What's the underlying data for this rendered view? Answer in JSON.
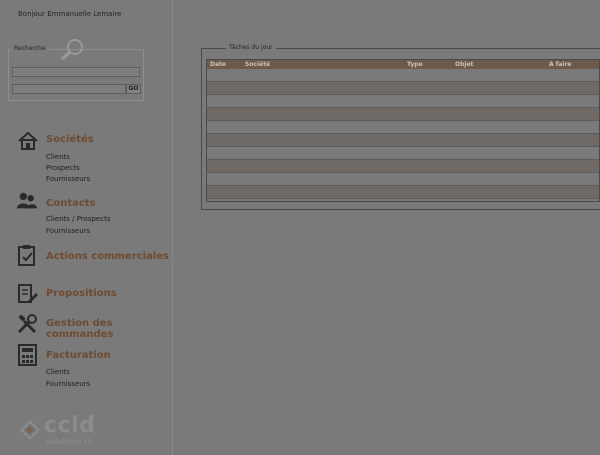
{
  "header": {
    "greeting": "Bonjour Emmanuelle Lemaire"
  },
  "search": {
    "legend": "Recherche",
    "input_value": "",
    "input2_value": "",
    "go_label": "GO"
  },
  "nav": {
    "societes": {
      "title": "Sociétés",
      "items": [
        "Clients",
        "Prospects",
        "Fournisseurs"
      ]
    },
    "contacts": {
      "title": "Contacts",
      "items": [
        "Clients / Prospects",
        "Fournisseurs"
      ]
    },
    "actions": {
      "title": "Actions commerciales"
    },
    "propositions": {
      "title": "Propositions"
    },
    "commandes": {
      "title": "Gestion des commandes"
    },
    "facturation": {
      "title": "Facturation",
      "items": [
        "Clients",
        "Fournisseurs"
      ]
    }
  },
  "logo": {
    "name": "ccld",
    "tagline": "solutions rh"
  },
  "tasks": {
    "legend": "Tâches du jour",
    "columns": [
      "Date",
      "Société",
      "Type",
      "Objet",
      "A faire"
    ],
    "rows": 10
  },
  "colors": {
    "accent": "#6e4b30",
    "table_header": "#6e5a4b",
    "overlay_gray": "#7a7a7a"
  }
}
